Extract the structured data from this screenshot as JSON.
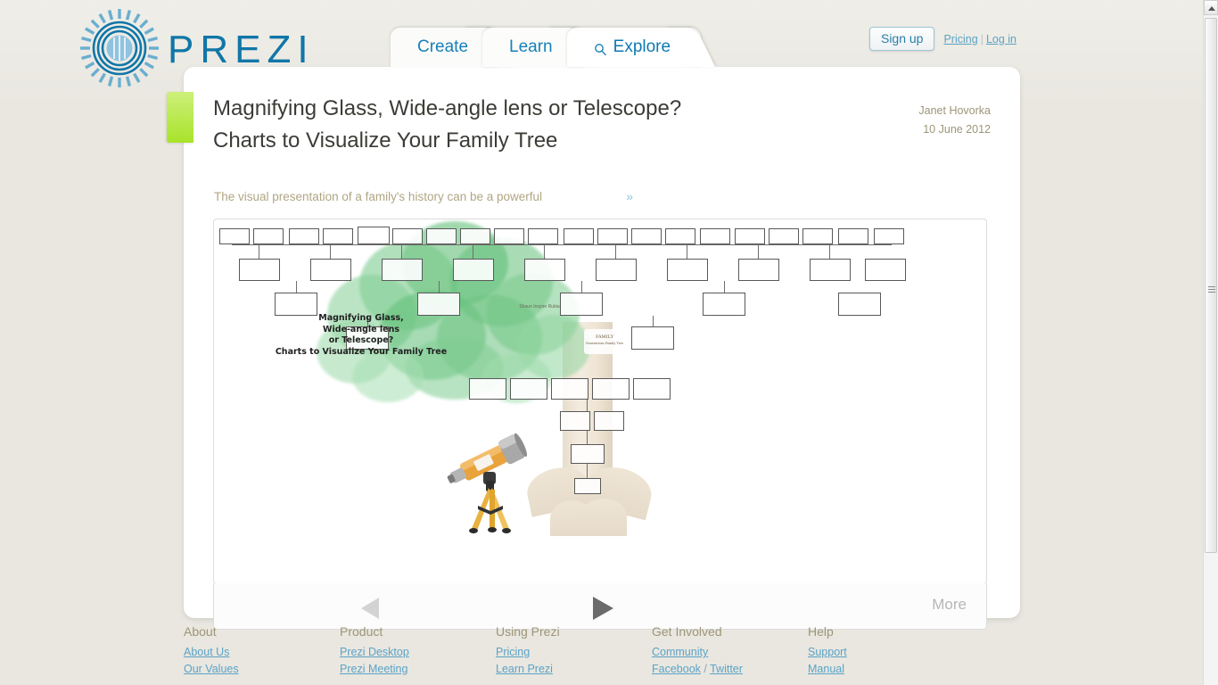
{
  "brand": {
    "wordmark": "Prezi",
    "logo_icon": "prezi-sunburst-logo",
    "color": "#1076a8"
  },
  "nav": {
    "tabs": [
      {
        "label": "Create",
        "icon": null,
        "active": false
      },
      {
        "label": "Learn",
        "icon": null,
        "active": false
      },
      {
        "label": "Explore",
        "icon": "search-icon",
        "active": true
      }
    ]
  },
  "auth": {
    "signup_label": "Sign up",
    "pricing_label": "Pricing",
    "separator": "|",
    "login_label": "Log in"
  },
  "post": {
    "title": "Magnifying Glass, Wide-angle lens or Telescope? Charts to Visualize Your Family Tree",
    "author": "Janet Hovorka",
    "date": "10 June 2012",
    "subtitle": "The visual presentation of a family's history can be a powerful",
    "expand_chevron": "»",
    "accent_color": "#a8e32a"
  },
  "canvas": {
    "heading_lines": [
      "Magnifying Glass,",
      "Wide-angle lens",
      "or Telescope?",
      "Charts to Visualize Your Family Tree"
    ],
    "center_caption": "Shaun Inspire Rubia",
    "watermark_text": "FAMILY",
    "watermark_sub": "Generations Family Tree",
    "telescope_icon": "telescope-illustration",
    "tree_icon": "family-tree-illustration"
  },
  "player": {
    "prev_icon": "triangle-left-icon",
    "next_icon": "triangle-right-icon",
    "more_label": "More"
  },
  "footer": {
    "columns": [
      {
        "heading": "About",
        "links": [
          "About Us",
          "Our Values"
        ]
      },
      {
        "heading": "Product",
        "links": [
          "Prezi Desktop",
          "Prezi Meeting"
        ]
      },
      {
        "heading": "Using Prezi",
        "links": [
          "Pricing",
          "Learn Prezi"
        ]
      },
      {
        "heading": "Get Involved",
        "links": [
          "Community"
        ],
        "pair": {
          "first": "Facebook",
          "sep": " / ",
          "second": "Twitter"
        }
      },
      {
        "heading": "Help",
        "links": [
          "Support",
          "Manual"
        ]
      }
    ]
  },
  "scrollbar": {
    "up_arrow_icon": "scroll-up-arrow-icon",
    "thumb_icon": "scrollbar-thumb"
  }
}
